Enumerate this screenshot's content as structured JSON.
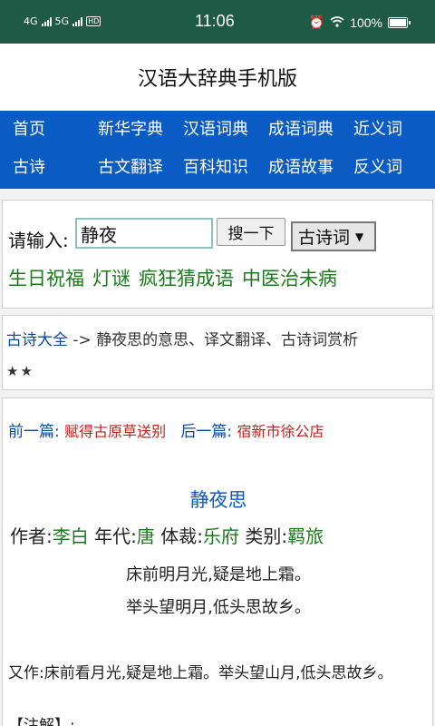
{
  "status": {
    "network_left": "4G",
    "network_right": "5G",
    "hd": "HD",
    "time": "11:06",
    "battery": "100%",
    "icons": [
      "signal-icon",
      "alarm-icon",
      "wifi-icon",
      "battery-icon"
    ]
  },
  "app": {
    "title": "汉语大辞典手机版"
  },
  "nav": {
    "row1": [
      "首页",
      "新华字典",
      "汉语词典",
      "成语词典",
      "近义词"
    ],
    "row2": [
      "古诗",
      "古文翻译",
      "百科知识",
      "成语故事",
      "反义词"
    ]
  },
  "search": {
    "label": "请输入:",
    "value": "静夜",
    "button": "搜一下",
    "select_value": "古诗词"
  },
  "quick_links": [
    "生日祝福",
    "灯谜",
    "疯狂猜成语",
    "中医治未病"
  ],
  "breadcrumb": {
    "link": "古诗大全",
    "arrow": " -> ",
    "text": "静夜思的意思、译文翻译、古诗词赏析",
    "stars": "★★"
  },
  "article": {
    "prev_label": "前一篇:",
    "prev_title": "赋得古原草送别",
    "next_label": "后一篇:",
    "next_title": "宿新市徐公店",
    "title": "静夜思",
    "author_label": "作者:",
    "author": "李白",
    "era_label": "年代:",
    "era": "唐",
    "genre_label": "体裁:",
    "genre": "乐府",
    "category_label": "类别:",
    "category": "羁旅",
    "lines": [
      "床前明月光,疑是地上霜。",
      "举头望明月,低头思故乡。"
    ],
    "alt_version": "又作:床前看月光,疑是地上霜。举头望山月,低头思故乡。",
    "note": "【注解】:"
  },
  "colors": {
    "statusbar": "#1e5a45",
    "nav": "#0a5bc4",
    "link_green": "#1a7a1a",
    "link_red": "#c0231e"
  }
}
